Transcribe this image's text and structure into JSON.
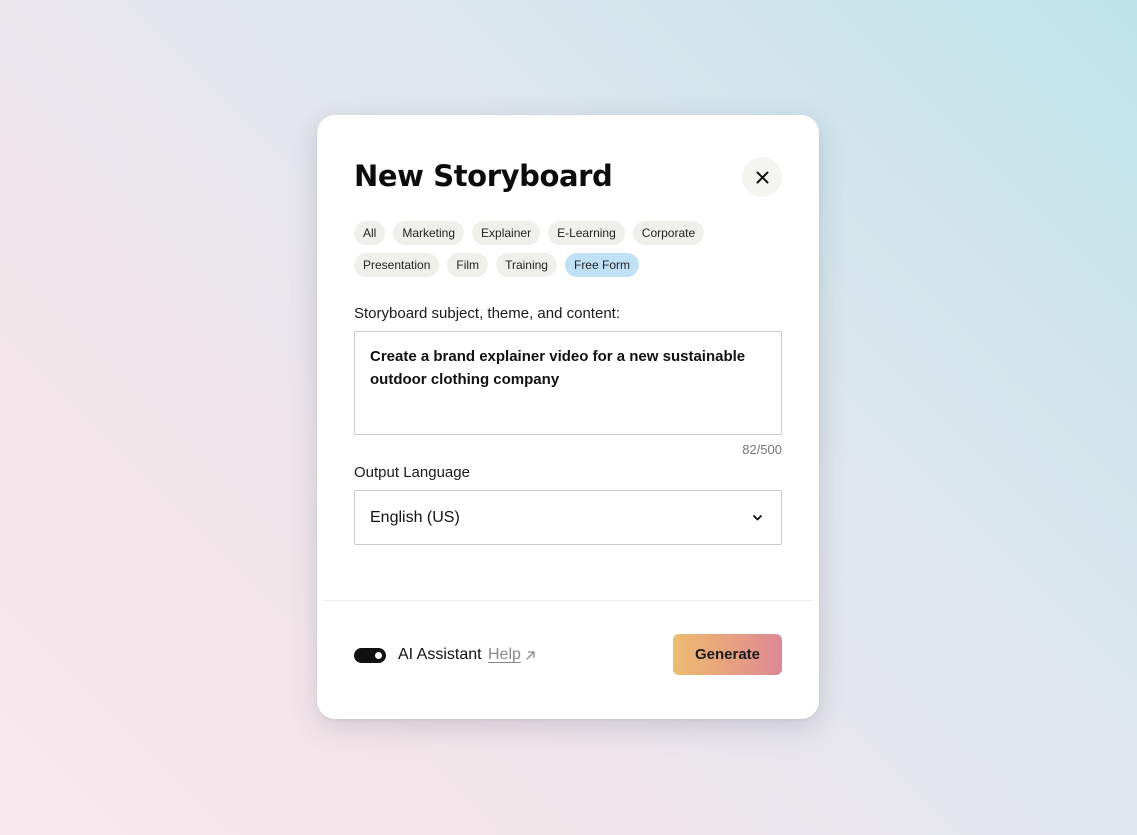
{
  "dialog": {
    "title": "New Storyboard",
    "close_icon": "close-icon"
  },
  "categories": {
    "row1": [
      "All",
      "Marketing",
      "Explainer",
      "E-Learning",
      "Corporate"
    ],
    "row2": [
      "Presentation",
      "Film",
      "Training",
      "Free Form"
    ],
    "selected": "Free Form"
  },
  "prompt": {
    "label": "Storyboard subject, theme, and content:",
    "value": "Create a brand explainer video for a new sustainable outdoor clothing company",
    "counter": "82/500"
  },
  "language": {
    "label": "Output Language",
    "value": "English (US)",
    "icon": "chevron-down-icon"
  },
  "footer": {
    "ai_assistant_label": "AI Assistant",
    "ai_assistant_enabled": true,
    "help_label": "Help",
    "help_icon": "external-arrow-icon",
    "generate_label": "Generate"
  },
  "colors": {
    "chip_selected": "#bfe0f5",
    "chip_default": "#efefec",
    "generate_gradient_start": "#ecbc71",
    "generate_gradient_end": "#de8896",
    "toggle_on": "#111111"
  }
}
